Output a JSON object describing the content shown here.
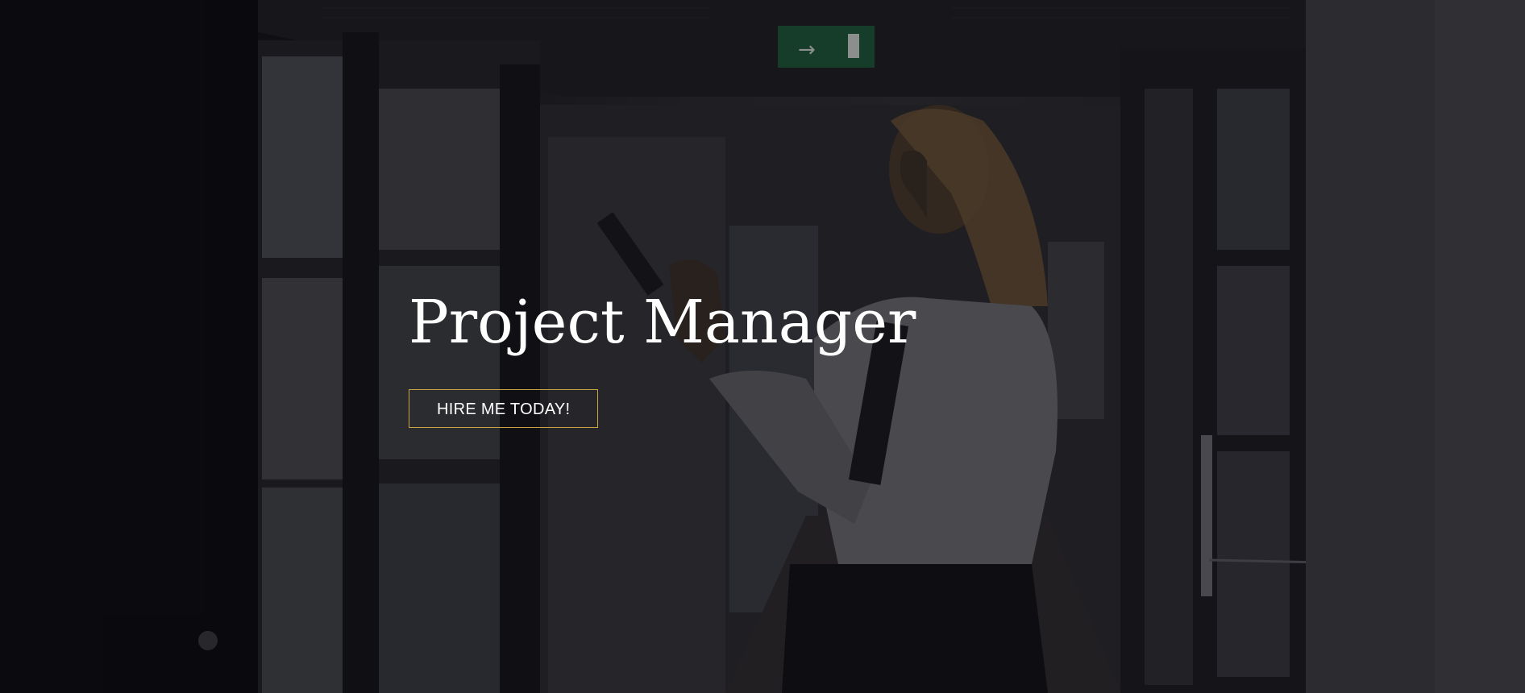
{
  "hero": {
    "title": "Project Manager",
    "cta_label": "HIRE ME TODAY!",
    "background_icon": "office-corridor-photo",
    "colors": {
      "title": "#ffffff",
      "cta_border": "#c8a446",
      "cta_text": "#ffffff",
      "overlay": "#0a0a0e"
    }
  }
}
